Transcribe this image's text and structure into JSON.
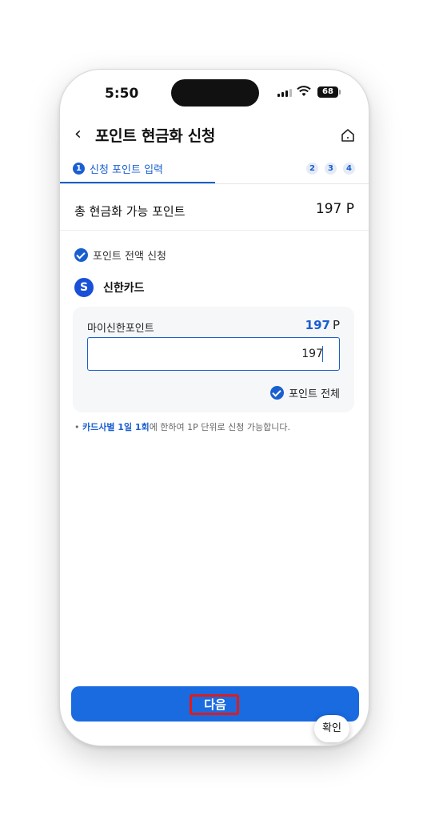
{
  "status_bar": {
    "time": "5:50",
    "battery": "68"
  },
  "header": {
    "title": "포인트 현금화 신청"
  },
  "steps": {
    "active_num": "1",
    "active_label": "신청 포인트 입력",
    "rest": [
      "2",
      "3",
      "4"
    ]
  },
  "total": {
    "label": "총 현금화 가능 포인트",
    "value": "197 P"
  },
  "all_apply_label": "포인트 전액 신청",
  "card": {
    "logo": "S",
    "name": "신한카드"
  },
  "point_panel": {
    "label": "마이신한포인트",
    "value": "197",
    "unit": "P",
    "input_value": "197",
    "all_points_label": "포인트 전체"
  },
  "notice": {
    "bullet": "•",
    "highlight": "카드사별 1일 1회",
    "text": "에 한하여 1P 단위로 신청 가능합니다."
  },
  "buttons": {
    "next": "다음",
    "confirm": "확인"
  },
  "colors": {
    "accent": "#1a5fd0",
    "button": "#1a6ae0",
    "highlight_box": "#e01b1b"
  }
}
